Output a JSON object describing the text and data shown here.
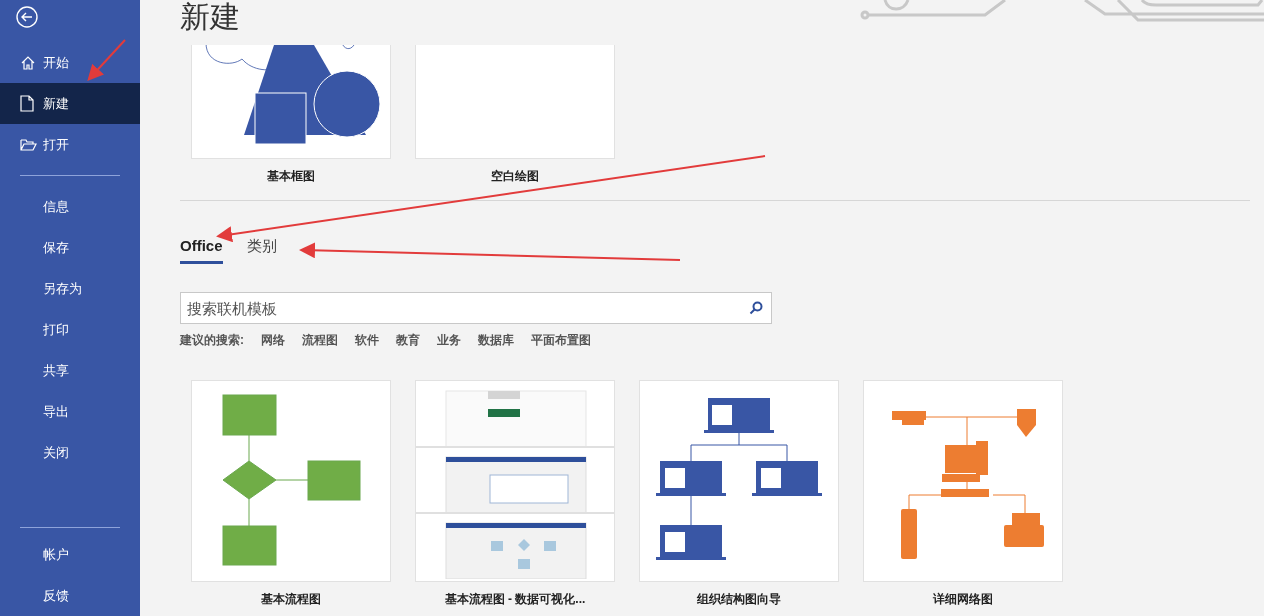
{
  "sidebar": {
    "items": [
      {
        "label": "开始",
        "kind": "home",
        "selected": false
      },
      {
        "label": "新建",
        "kind": "page",
        "selected": true
      },
      {
        "label": "打开",
        "kind": "folder",
        "selected": false
      },
      {
        "label": "信息",
        "selected": false
      },
      {
        "label": "保存",
        "selected": false
      },
      {
        "label": "另存为",
        "selected": false
      },
      {
        "label": "打印",
        "selected": false
      },
      {
        "label": "共享",
        "selected": false
      },
      {
        "label": "导出",
        "selected": false
      },
      {
        "label": "关闭",
        "selected": false
      }
    ],
    "bottom_items": [
      {
        "label": "帐户",
        "selected": false
      },
      {
        "label": "反馈",
        "selected": false
      }
    ]
  },
  "title": "新建",
  "featured": [
    {
      "label": "基本框图",
      "kind": "basic"
    },
    {
      "label": "空白绘图",
      "kind": "blank"
    }
  ],
  "tabs": [
    {
      "label": "Office",
      "selected": true
    },
    {
      "label": "类别",
      "selected": false
    }
  ],
  "search": {
    "placeholder": "搜索联机模板"
  },
  "suggested": {
    "label": "建议的搜索:",
    "items": [
      "网络",
      "流程图",
      "软件",
      "教育",
      "业务",
      "数据库",
      "平面布置图"
    ]
  },
  "templates": [
    {
      "label": "基本流程图",
      "kind": "flowchart"
    },
    {
      "label": "基本流程图 - 数据可视化...",
      "kind": "datavis"
    },
    {
      "label": "组织结构图向导",
      "kind": "orgchart"
    },
    {
      "label": "详细网络图",
      "kind": "network"
    }
  ]
}
